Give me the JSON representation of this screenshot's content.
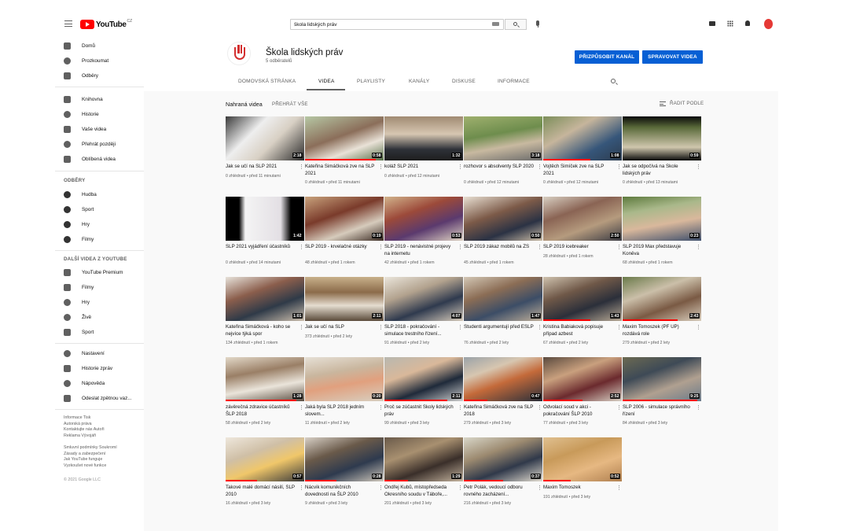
{
  "topbar": {
    "logo_text": "YouTube",
    "logo_country": "CZ",
    "search_value": "škola lidských práv"
  },
  "sidebar": {
    "main": [
      {
        "label": "Domů",
        "icon": "home-icon"
      },
      {
        "label": "Prozkoumat",
        "icon": "compass-icon"
      },
      {
        "label": "Odběry",
        "icon": "subscriptions-icon"
      }
    ],
    "library": [
      {
        "label": "Knihovna",
        "icon": "library-icon"
      },
      {
        "label": "Historie",
        "icon": "history-icon"
      },
      {
        "label": "Vaše videa",
        "icon": "your-videos-icon"
      },
      {
        "label": "Přehrát později",
        "icon": "clock-icon"
      },
      {
        "label": "Oblíbená videa",
        "icon": "thumbs-up-icon"
      }
    ],
    "subscriptions_heading": "ODBĚRY",
    "subscriptions": [
      {
        "label": "Hudba",
        "icon": "music-icon"
      },
      {
        "label": "Sport",
        "icon": "sport-icon"
      },
      {
        "label": "Hry",
        "icon": "gaming-icon"
      },
      {
        "label": "Filmy",
        "icon": "movies-icon"
      }
    ],
    "more_heading": "DALŠÍ VIDEA Z YOUTUBE",
    "more": [
      {
        "label": "YouTube Premium",
        "icon": "youtube-premium-icon"
      },
      {
        "label": "Filmy",
        "icon": "film-icon"
      },
      {
        "label": "Hry",
        "icon": "controller-icon"
      },
      {
        "label": "Živě",
        "icon": "live-icon"
      },
      {
        "label": "Sport",
        "icon": "trophy-icon"
      }
    ],
    "settings": [
      {
        "label": "Nastavení",
        "icon": "gear-icon"
      },
      {
        "label": "Historie zpráv",
        "icon": "flag-icon"
      },
      {
        "label": "Nápověda",
        "icon": "help-icon"
      },
      {
        "label": "Odeslat zpětnou vaz...",
        "icon": "feedback-icon"
      }
    ],
    "footer1": "Informace  Tisk\nAutorská práva\nKontaktujte nás  Autoři\nReklama  Vývojáři",
    "footer2": "Smluvní podmínky  Soukromí\nZásady a zabezpečení\nJak YouTube funguje\nVyzkoušet nové funkce",
    "copyright": "© 2021 Google LLC"
  },
  "channel": {
    "name": "Škola lidských práv",
    "subscribers": "5 odběratelů",
    "customize_label": "PŘIZPŮSOBIT KANÁL",
    "manage_label": "SPRAVOVAT VIDEA",
    "tabs": [
      "DOMOVSKÁ STRÁNKA",
      "VIDEA",
      "PLAYLISTY",
      "KANÁLY",
      "DISKUSE",
      "INFORMACE"
    ],
    "active_tab": "VIDEA"
  },
  "uploads": {
    "title": "Nahraná videa",
    "play_all": "PŘEHRÁT VŠE",
    "sort_label": "ŘADIT PODLE"
  },
  "videos": [
    {
      "title": "Jak se učí na ŠLP 2021",
      "duration": "2:18",
      "meta": "0 zhlédnutí • před 11 minutami"
    },
    {
      "title": "Kateřina Šimáčková zve na ŠLP 2021",
      "duration": "0:58",
      "meta": "0 zhlédnutí • před 11 minutami"
    },
    {
      "title": "koláž ŠLP 2021",
      "duration": "1:32",
      "meta": "0 zhlédnutí • před 12 minutami"
    },
    {
      "title": "rozhovor s absolventy ŠLP 2020",
      "duration": "3:18",
      "meta": "0 zhlédnutí • před 12 minutami"
    },
    {
      "title": "Vojtěch Šimíček zve na ŠLP 2021",
      "duration": "1:08",
      "meta": "0 zhlédnutí • před 12 minutami"
    },
    {
      "title": "Jak se odpočívá na Škole lidských práv",
      "duration": "0:59",
      "meta": "0 zhlédnutí • před 13 minutami"
    },
    {
      "title": "ŠLP 2021 vyjádření účastníků",
      "duration": "1:42",
      "meta": "0 zhlédnutí • před 14 minutami"
    },
    {
      "title": "ŠLP 2019 - krvelačné otázky",
      "duration": "0:19",
      "meta": "48 zhlédnutí • před 1 rokem"
    },
    {
      "title": "ŠLP 2019 - nenávistné projevy na internetu",
      "duration": "0:53",
      "meta": "42 zhlédnutí • před 1 rokem"
    },
    {
      "title": "ŠLP 2019 zákaz mobilů na ZŠ",
      "duration": "0:50",
      "meta": "45 zhlédnutí • před 1 rokem"
    },
    {
      "title": "ŠLP 2019 icebreaker",
      "duration": "2:50",
      "meta": "28 zhlédnutí • před 1 rokem"
    },
    {
      "title": "ŠLP 2019 Max představuje Koněva",
      "duration": "0:23",
      "meta": "68 zhlédnutí • před 1 rokem"
    },
    {
      "title": "Kateřina Šimáčková - koho se nejvíce týká spor",
      "duration": "1:01",
      "meta": "134 zhlédnutí • před 1 rokem"
    },
    {
      "title": "Jak se učí na ŠLP",
      "duration": "2:11",
      "meta": "373 zhlédnutí • před 2 lety"
    },
    {
      "title": "ŠLP 2018 - pokračování - simulace trestního řízení...",
      "duration": "4:07",
      "meta": "91 zhlédnutí • před 2 lety"
    },
    {
      "title": "Studenti argumentují před ESLP",
      "duration": "1:47",
      "meta": "76 zhlédnutí • před 2 lety"
    },
    {
      "title": "Kristina Babiaková popisuje případ azbest",
      "duration": "1:43",
      "meta": "67 zhlédnutí • před 2 lety"
    },
    {
      "title": "Maxim Tomoszek (PF UP) rozdává role",
      "duration": "2:43",
      "meta": "279 zhlédnutí • před 2 lety"
    },
    {
      "title": "závěrečná zdravice účastníků ŠLP 2018",
      "duration": "1:28",
      "meta": "58 zhlédnutí • před 2 lety"
    },
    {
      "title": "Jaká byla ŠLP 2018 jedním slovem...",
      "duration": "0:20",
      "meta": "11 zhlédnutí • před 2 lety"
    },
    {
      "title": "Proč se zúčastnit Školy lidských práv",
      "duration": "2:11",
      "meta": "99 zhlédnutí • před 3 lety"
    },
    {
      "title": "Kateřina Šimáčková zve na ŠLP 2018",
      "duration": "0:47",
      "meta": "279 zhlédnutí • před 3 lety"
    },
    {
      "title": "Odvolací soud v akci - pokračování ŠLP 2010",
      "duration": "2:52",
      "meta": "77 zhlédnutí • před 3 lety"
    },
    {
      "title": "ŠLP 2006 - simulace správního řízení",
      "duration": "9:25",
      "meta": "84 zhlédnutí • před 3 lety"
    },
    {
      "title": "Takové malé domácí násilí, ŠLP 2010",
      "duration": "0:57",
      "meta": "16 zhlédnutí • před 3 lety"
    },
    {
      "title": "Nácvik komunikčních dovedností na ŠLP 2010",
      "duration": "0:28",
      "meta": "9 zhlédnutí • před 3 lety"
    },
    {
      "title": "Ondřej Kubů, místopředseda Okresního soudu v Táboře,...",
      "duration": "1:29",
      "meta": "201 zhlédnutí • před 3 lety"
    },
    {
      "title": "Petr Polák, vedoucí odboru rovného zacházení...",
      "duration": "0:37",
      "meta": "216 zhlédnutí • před 3 lety"
    },
    {
      "title": "Maxim Tomoszek",
      "duration": "0:52",
      "meta": "191 zhlédnutí • před 3 lety"
    }
  ]
}
